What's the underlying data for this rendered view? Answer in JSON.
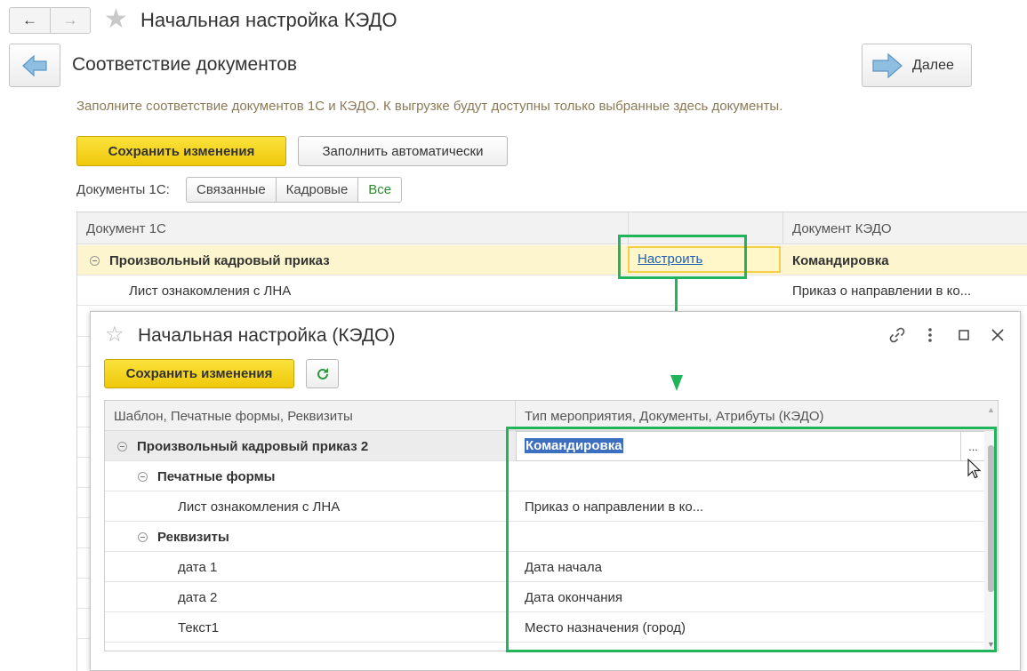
{
  "window": {
    "title": "Начальная настройка КЭДО"
  },
  "page": {
    "title": "Соответствие документов",
    "next_label": "Далее",
    "hint": "Заполните соответствие документов 1С и КЭДО. К выгрузке будут доступны только выбранные здесь документы.",
    "save_label": "Сохранить изменения",
    "autofill_label": "Заполнить автоматически",
    "filter_label": "Документы 1С:",
    "filters": [
      "Связанные",
      "Кадровые",
      "Все"
    ]
  },
  "main_table": {
    "columns": [
      "Документ 1С",
      "",
      "Документ КЭДО"
    ],
    "rows": [
      {
        "doc1c": "Произвольный кадровый приказ",
        "action": "Настроить",
        "kedo": "Командировка"
      },
      {
        "doc1c": "Лист ознакомления с ЛНА",
        "action": "",
        "kedo": "Приказ о направлении в ко..."
      }
    ]
  },
  "dialog": {
    "title": "Начальная настройка (КЭДО)",
    "save_label": "Сохранить изменения",
    "columns": [
      "Шаблон, Печатные формы, Реквизиты",
      "Тип мероприятия, Документы, Атрибуты (КЭДО)"
    ],
    "rows": [
      {
        "left": "Произвольный кадровый приказ 2",
        "right": "Командировка",
        "level": 0,
        "group": true
      },
      {
        "left": "Печатные формы",
        "right": "",
        "level": 1,
        "group": true
      },
      {
        "left": "Лист ознакомления с ЛНА",
        "right": "Приказ о направлении в ко...",
        "level": 2,
        "group": false
      },
      {
        "left": "Реквизиты",
        "right": "",
        "level": 1,
        "group": true
      },
      {
        "left": "дата 1",
        "right": "Дата начала",
        "level": 2,
        "group": false
      },
      {
        "left": "дата 2",
        "right": "Дата окончания",
        "level": 2,
        "group": false
      },
      {
        "left": "Текст1",
        "right": "Место назначения (город)",
        "level": 2,
        "group": false
      }
    ],
    "select_button": "..."
  },
  "colors": {
    "accent_yellow": "#f5d21a",
    "highlight_green": "#22b45a",
    "link_blue": "#1d5fb5"
  }
}
